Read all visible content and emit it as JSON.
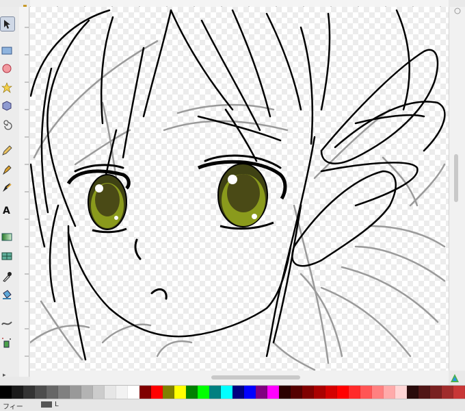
{
  "app": {
    "status_label": "フィー",
    "fill_label": "L"
  },
  "toolbox": {
    "tools": [
      "selector-tool-icon",
      "node-tool-icon",
      "rectangle-tool-icon",
      "ellipse-tool-icon",
      "star-tool-icon",
      "3d-box-tool-icon",
      "spiral-tool-icon",
      "pencil-tool-icon",
      "pen-tool-icon",
      "calligraphy-tool-icon",
      "text-tool-icon",
      "gradient-tool-icon",
      "mesh-tool-icon",
      "dropper-tool-icon",
      "paint-bucket-tool-icon",
      "tweak-tool-icon",
      "spray-tool-icon"
    ]
  },
  "palette": {
    "colors": [
      "#000000",
      "#1a1a1a",
      "#333333",
      "#4d4d4d",
      "#666666",
      "#808080",
      "#999999",
      "#b3b3b3",
      "#cccccc",
      "#e6e6e6",
      "#f2f2f2",
      "#ffffff",
      "#800000",
      "#ff0000",
      "#808000",
      "#ffff00",
      "#008000",
      "#00ff00",
      "#008080",
      "#00ffff",
      "#000080",
      "#0000ff",
      "#800080",
      "#ff00ff",
      "#2b0000",
      "#550000",
      "#800000",
      "#aa0000",
      "#d40000",
      "#ff0000",
      "#ff2a2a",
      "#ff5555",
      "#ff8080",
      "#ffaaaa",
      "#ffd5d5",
      "#280b0b",
      "#501616",
      "#782121",
      "#a02c2c",
      "#c83737"
    ]
  },
  "colors": {
    "eye_iris": "#8a9a1c",
    "eye_dark": "#3f4214",
    "line_art": "#000000",
    "sketch": "#9a9a9a"
  }
}
